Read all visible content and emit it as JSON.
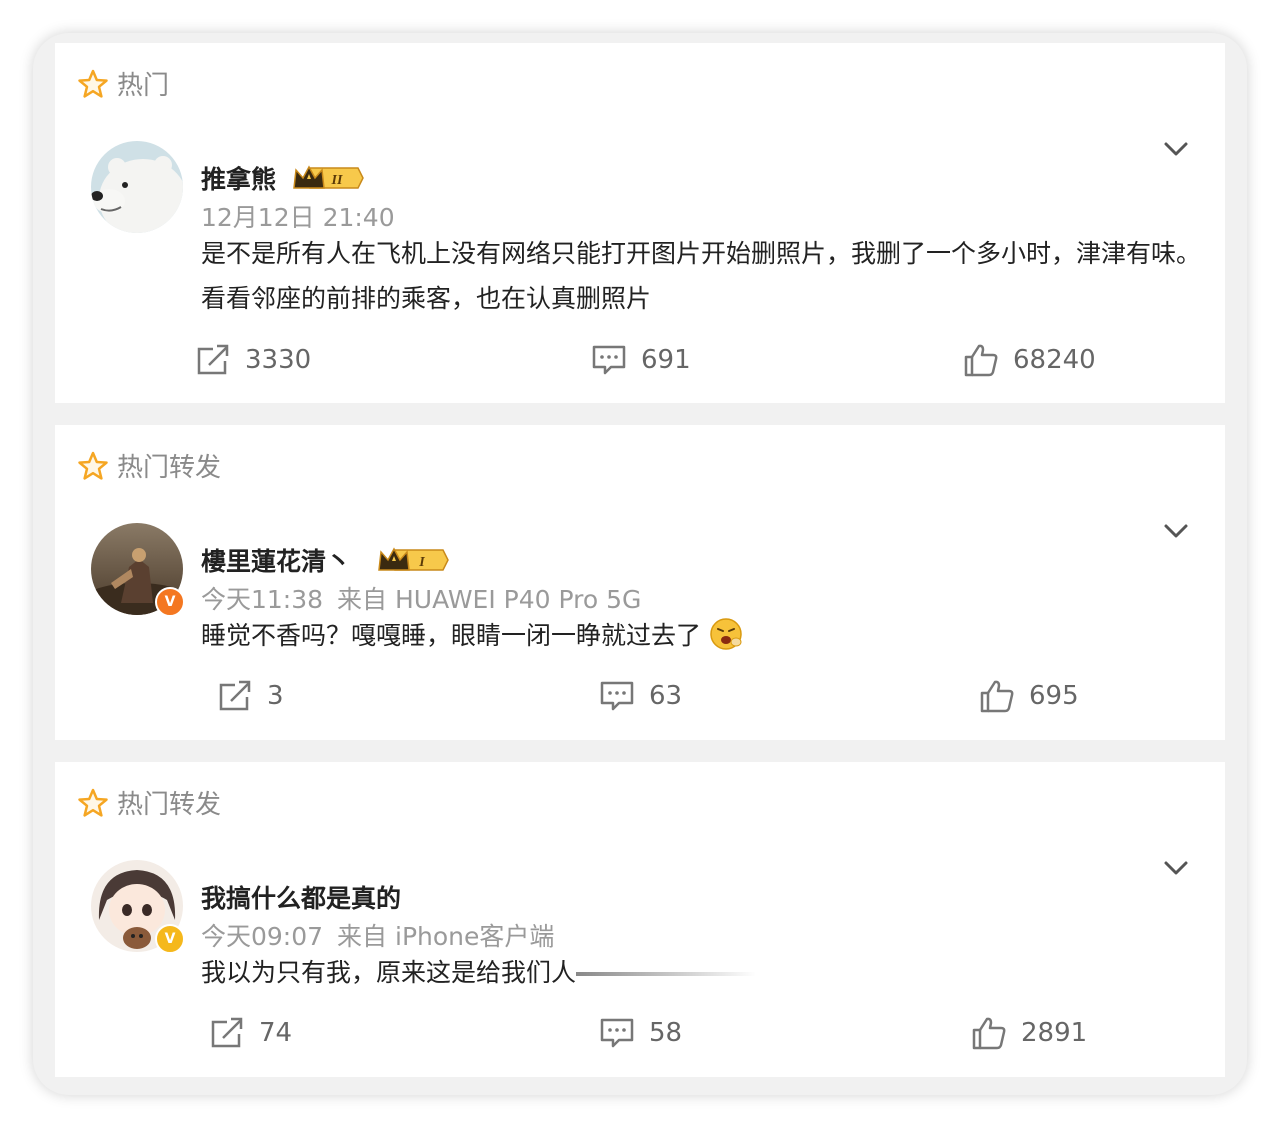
{
  "posts": [
    {
      "section_label": "热门",
      "username": "推拿熊",
      "level_badge": "II",
      "meta": {
        "time": "12月12日 21:40",
        "source": ""
      },
      "content": "是不是所有人在飞机上没有网络只能打开图片开始删照片，我删了一个多小时，津津有味。看看邻座的前排的乘客，也在认真删照片",
      "stats": {
        "reposts": "3330",
        "comments": "691",
        "likes": "68240"
      }
    },
    {
      "section_label": "热门转发",
      "username": "樓里蓮花清丶",
      "level_badge": "I",
      "meta": {
        "time": "今天11:38",
        "source": "来自 HUAWEI P40 Pro 5G"
      },
      "content": "睡觉不香吗？嘎嘎睡，眼睛一闭一睁就过去了",
      "stats": {
        "reposts": "3",
        "comments": "63",
        "likes": "695"
      }
    },
    {
      "section_label": "热门转发",
      "username": "我搞什么都是真的",
      "level_badge": "",
      "meta": {
        "time": "今天09:07",
        "source": "来自 iPhone客户端"
      },
      "content": "我以为只有我，原来这是给我们人",
      "stats": {
        "reposts": "74",
        "comments": "58",
        "likes": "2891"
      }
    }
  ],
  "colors": {
    "accent_star": "#f5a623",
    "verified_orange": "#f47721",
    "verified_gold": "#f5b81c",
    "text_primary": "#222222",
    "text_secondary": "#9a9a9a"
  },
  "icons": [
    "star-icon",
    "crown-badge",
    "chevron-down-icon",
    "repost-icon",
    "comment-icon",
    "like-icon",
    "verified-icon",
    "emoji-icon"
  ]
}
